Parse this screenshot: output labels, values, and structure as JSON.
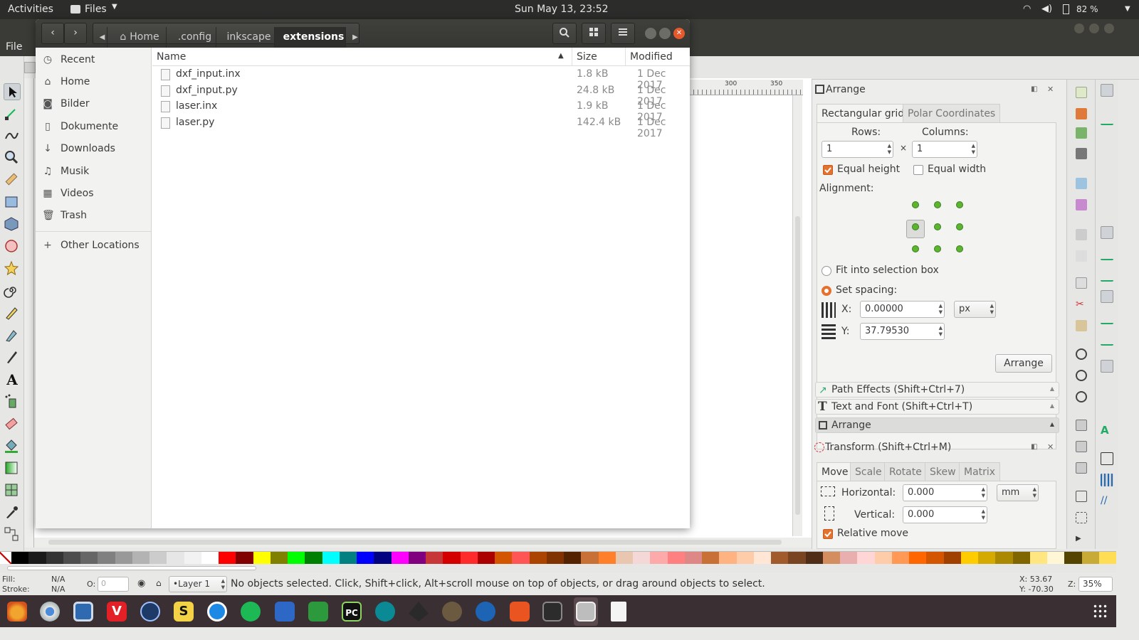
{
  "topbar": {
    "activities": "Activities",
    "app_menu": "Files",
    "clock": "Sun May 13, 23:52",
    "battery": "82 %"
  },
  "inkscape": {
    "menu_file": "File",
    "ruler_300": "300",
    "ruler_350": "350",
    "arrange": {
      "title": "Arrange",
      "tab_rect": "Rectangular grid",
      "tab_polar": "Polar Coordinates",
      "rows_label": "Rows:",
      "columns_label": "Columns:",
      "rows_value": "1",
      "columns_value": "1",
      "times": "×",
      "equal_height": "Equal height",
      "equal_width": "Equal width",
      "alignment_label": "Alignment:",
      "fit_label": "Fit into selection box",
      "set_spacing_label": "Set spacing:",
      "x_label": "X:",
      "x_value": "0.00000",
      "y_label": "Y:",
      "y_value": "37.79530",
      "unit": "px",
      "arrange_button": "Arrange"
    },
    "path_effects": "Path Effects  (Shift+Ctrl+7)",
    "text_font": "Text and Font (Shift+Ctrl+T)",
    "arrange_collapsed": "Arrange",
    "transform": {
      "title": "Transform (Shift+Ctrl+M)",
      "tabs": [
        "Move",
        "Scale",
        "Rotate",
        "Skew",
        "Matrix"
      ],
      "horizontal_label": "Horizontal:",
      "horizontal_value": "0.000",
      "vertical_label": "Vertical:",
      "vertical_value": "0.000",
      "unit": "mm",
      "relative_move": "Relative move"
    },
    "status": {
      "fill_label": "Fill:",
      "fill_value": "N/A",
      "stroke_label": "Stroke:",
      "stroke_value": "N/A",
      "opacity_label": "O:",
      "opacity_value": "0",
      "layer": "•Layer 1",
      "message": "No objects selected. Click, Shift+click, Alt+scroll mouse on top of objects, or drag around objects to select.",
      "x_coord": "X:    53.67",
      "y_coord": "Y:   -70.30",
      "zoom_label": "Z:",
      "zoom_value": "35%"
    },
    "palette": [
      "#000000",
      "#1a1a1a",
      "#333333",
      "#4d4d4d",
      "#666666",
      "#808080",
      "#999999",
      "#b3b3b3",
      "#cccccc",
      "#e6e6e6",
      "#f2f2f2",
      "#ffffff",
      "#ff0000",
      "#800000",
      "#ffff00",
      "#808000",
      "#00ff00",
      "#008000",
      "#00ffff",
      "#008080",
      "#0000ff",
      "#000080",
      "#ff00ff",
      "#800080",
      "#c83737",
      "#d40000",
      "#ff2a2a",
      "#aa0000",
      "#d45500",
      "#ff5555",
      "#aa4400",
      "#803300",
      "#552200",
      "#c87137",
      "#ff7f2a",
      "#e9c6af",
      "#f4d7d7",
      "#ffaaaa",
      "#ff8080",
      "#de8787",
      "#c87137",
      "#ffb380",
      "#ffccaa",
      "#ffe6d5",
      "#a05a2c",
      "#784421",
      "#502d16",
      "#d38d5f",
      "#e9afaf",
      "#ffd5d5",
      "#ffccaa",
      "#ff9955",
      "#ff6600",
      "#d45500",
      "#a04000",
      "#ffcc00",
      "#d4aa00",
      "#aa8800",
      "#806600",
      "#ffe680",
      "#fff6d5",
      "#554400",
      "#c8ab37",
      "#ffdd55"
    ]
  },
  "files": {
    "crumbs": [
      "Home",
      ".config",
      "inkscape",
      "extensions"
    ],
    "sidebar": [
      "Recent",
      "Home",
      "Bilder",
      "Dokumente",
      "Downloads",
      "Musik",
      "Videos",
      "Trash"
    ],
    "other_locations": "Other Locations",
    "columns": {
      "name": "Name",
      "size": "Size",
      "modified": "Modified"
    },
    "rows": [
      {
        "name": "dxf_input.inx",
        "size": "1.8 kB",
        "modified": "1 Dec 2017"
      },
      {
        "name": "dxf_input.py",
        "size": "24.8 kB",
        "modified": "1 Dec 2017"
      },
      {
        "name": "laser.inx",
        "size": "1.9 kB",
        "modified": "1 Dec 2017"
      },
      {
        "name": "laser.py",
        "size": "142.4 kB",
        "modified": "1 Dec 2017"
      }
    ]
  }
}
